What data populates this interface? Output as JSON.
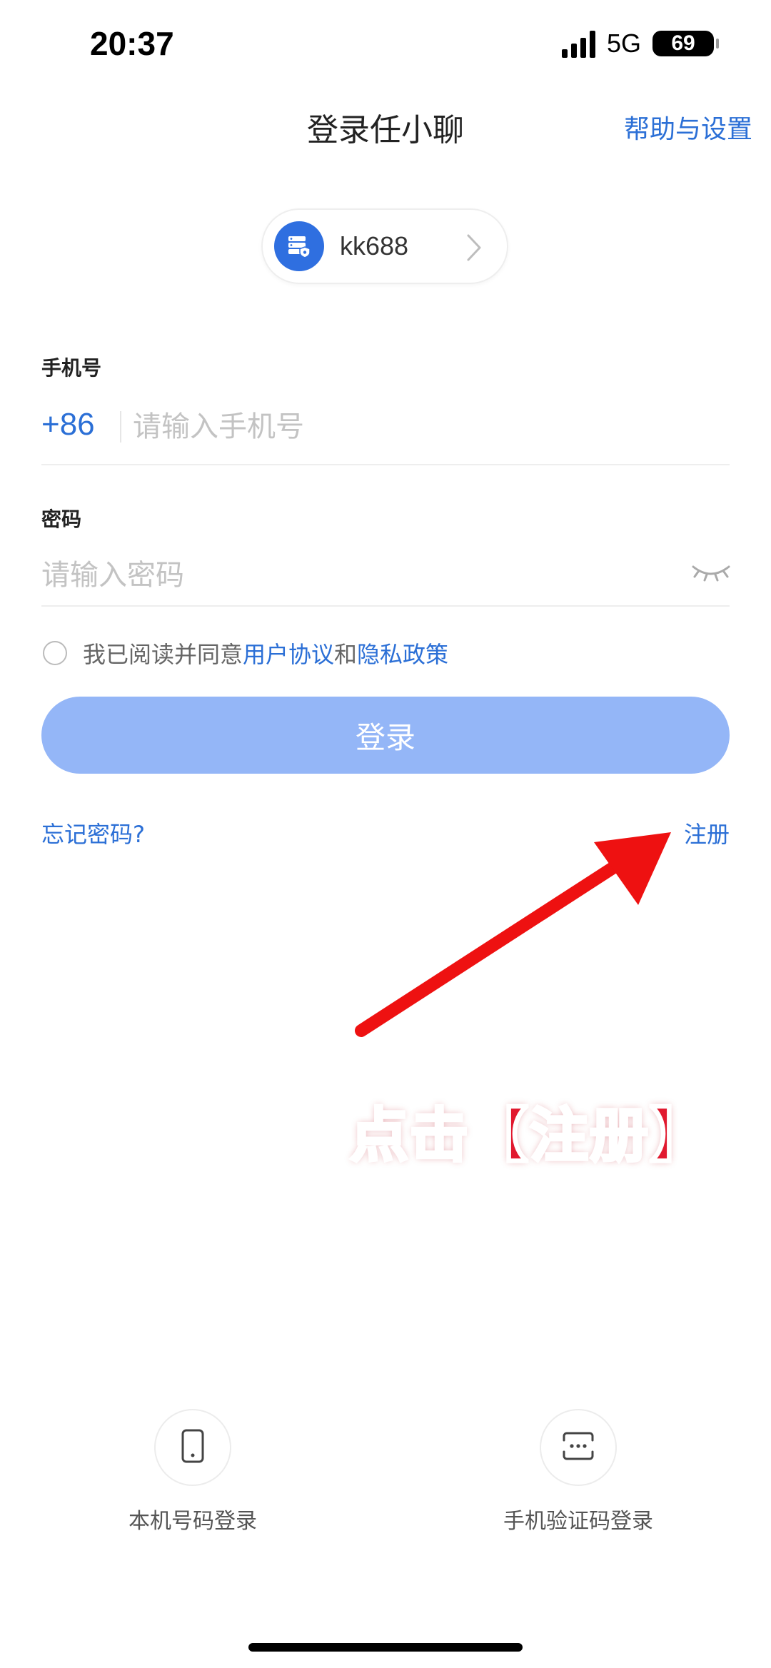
{
  "status_bar": {
    "time": "20:37",
    "network": "5G",
    "battery": "69"
  },
  "header": {
    "title": "登录任小聊",
    "help_link": "帮助与设置"
  },
  "server": {
    "name": "kk688",
    "icon": "server-shield-icon"
  },
  "phone": {
    "label": "手机号",
    "prefix": "+86",
    "placeholder": "请输入手机号",
    "value": ""
  },
  "password": {
    "label": "密码",
    "placeholder": "请输入密码",
    "value": "",
    "toggle_icon": "eye-closed-icon"
  },
  "agreement": {
    "prefix": "我已阅读并同意",
    "user_agreement": "用户协议",
    "and": "和",
    "privacy_policy": "隐私政策",
    "checked": false
  },
  "login_button": "登录",
  "links": {
    "forgot_password": "忘记密码?",
    "register": "注册"
  },
  "annotation": {
    "text": "点击【注册】",
    "color": "#e1192f"
  },
  "alt_login": {
    "local_number": {
      "label": "本机号码登录",
      "icon": "phone-icon"
    },
    "sms_code": {
      "label": "手机验证码登录",
      "icon": "sms-code-icon"
    }
  },
  "colors": {
    "accent": "#2b6fd6",
    "login_button_disabled": "#94b6f7",
    "server_icon_bg": "#2f6fe0"
  }
}
